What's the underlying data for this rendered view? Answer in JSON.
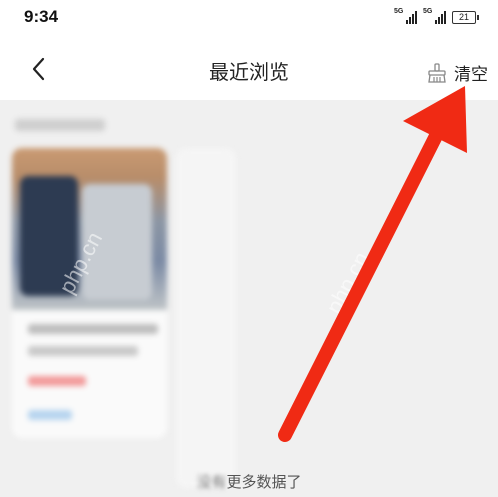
{
  "status": {
    "time": "9:34",
    "signal1_tag": "5G",
    "signal2_tag": "5G",
    "battery": "21"
  },
  "nav": {
    "back_icon": "chevron-left-icon",
    "title": "最近浏览",
    "clear_icon": "broom-icon",
    "clear_label": "清空"
  },
  "footer": {
    "hidden_prefix": "没有",
    "more_text": "更多数据了"
  },
  "watermark": {
    "text1": "php.cn",
    "text2": "php.cn"
  },
  "colors": {
    "arrow": "#f02a14",
    "nav_bg": "#ffffff",
    "content_bg": "#f0f0f0"
  }
}
